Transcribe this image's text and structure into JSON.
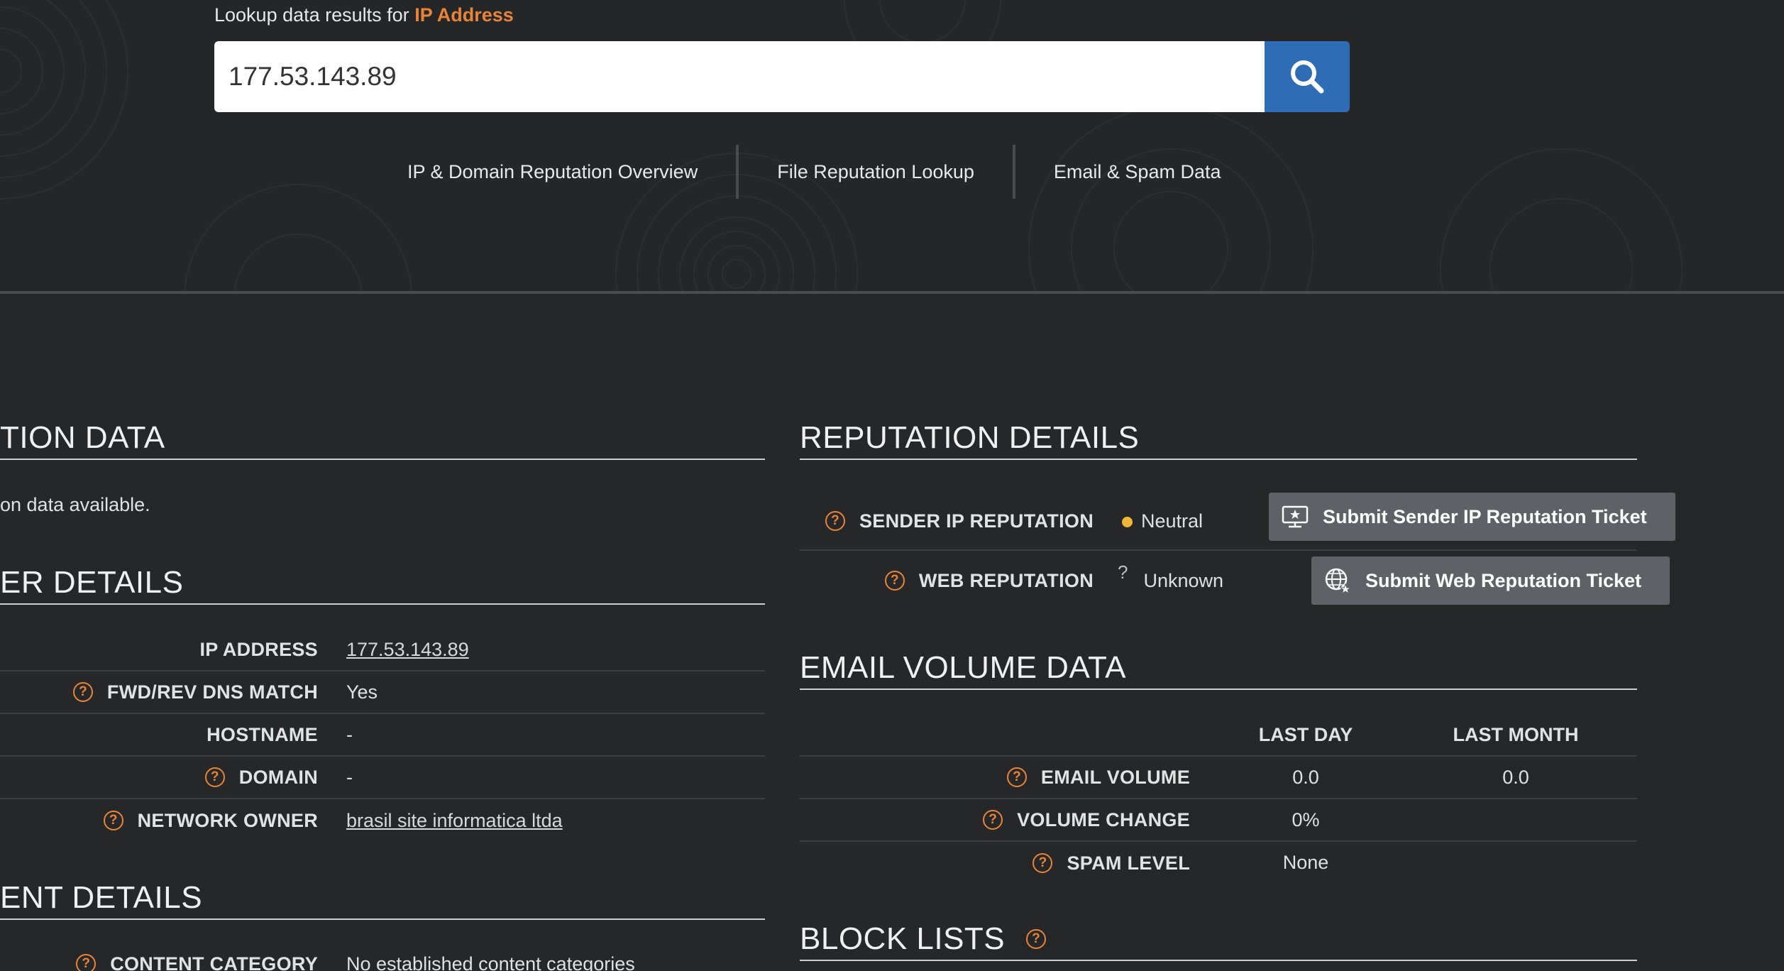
{
  "hero": {
    "lookup_prefix": "Lookup data results for",
    "lookup_type": "IP Address",
    "search_value": "177.53.143.89",
    "nav": [
      "IP & Domain Reputation Overview",
      "File Reputation Lookup",
      "Email & Spam Data"
    ]
  },
  "location": {
    "title": "TION DATA",
    "message": "on data available."
  },
  "owner": {
    "title": "ER DETAILS",
    "rows": [
      {
        "label": "IP ADDRESS",
        "value": "177.53.143.89"
      },
      {
        "label": "FWD/REV DNS MATCH",
        "value": "Yes"
      },
      {
        "label": "HOSTNAME",
        "value": "-"
      },
      {
        "label": "DOMAIN",
        "value": "-"
      },
      {
        "label": "NETWORK OWNER",
        "value": "brasil site informatica ltda"
      }
    ]
  },
  "content": {
    "title": "ENT DETAILS",
    "rows": [
      {
        "label": "CONTENT CATEGORY",
        "value": "No established content categories"
      }
    ]
  },
  "reputation": {
    "title": "REPUTATION DETAILS",
    "sender": {
      "label": "SENDER IP REPUTATION",
      "value": "Neutral",
      "button": "Submit Sender IP Reputation Ticket"
    },
    "web": {
      "label": "WEB REPUTATION",
      "value": "Unknown",
      "unknown_mark": "?",
      "button": "Submit Web Reputation Ticket"
    }
  },
  "email_volume": {
    "title": "EMAIL VOLUME DATA",
    "columns": [
      "LAST DAY",
      "LAST MONTH"
    ],
    "rows": [
      {
        "label": "EMAIL VOLUME",
        "last_day": "0.0",
        "last_month": "0.0"
      },
      {
        "label": "VOLUME CHANGE",
        "last_day": "0%",
        "last_month": ""
      },
      {
        "label": "SPAM LEVEL",
        "last_day": "None",
        "last_month": ""
      }
    ]
  },
  "block_lists": {
    "title": "BLOCK LISTS"
  },
  "colors": {
    "accent": "#e8843a",
    "search_button": "#2e6db5",
    "neutral_dot": "#f0b63a"
  }
}
